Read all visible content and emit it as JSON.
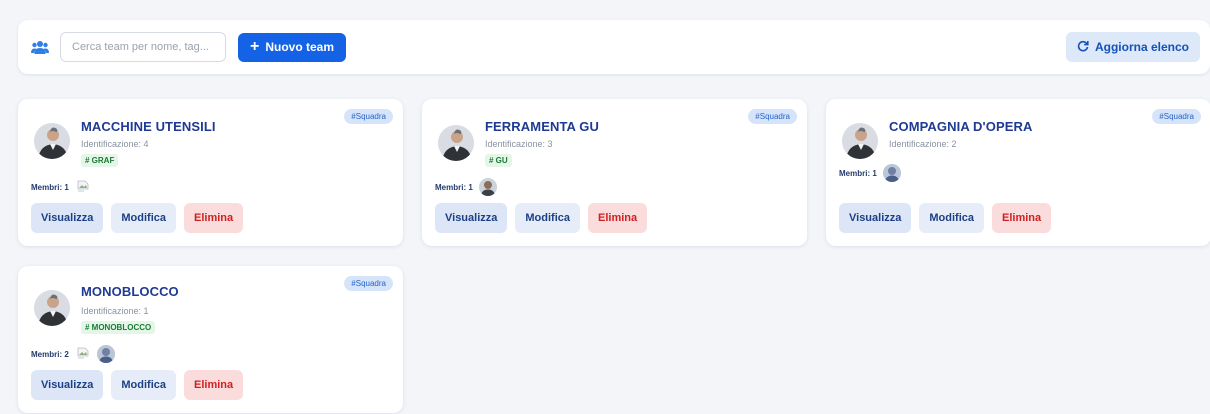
{
  "toolbar": {
    "icon": "users-icon",
    "search_placeholder": "Cerca team per nome, tag...",
    "search_value": "",
    "new_team_label": "Nuovo team",
    "refresh_label": "Aggiorna elenco"
  },
  "colors": {
    "primary": "#1463e6",
    "title": "#1f3a93",
    "danger": "#d01f1f",
    "tag_green": "#1e7a35"
  },
  "cards": [
    {
      "name": "MACCHINE UTENSILI",
      "ident": "Identificazione: 4",
      "tag": "# GRAF",
      "badge": "#Squadra",
      "members_label": "Membri: 1",
      "view": "Visualizza",
      "edit": "Modifica",
      "delete": "Elimina"
    },
    {
      "name": "FERRAMENTA GU",
      "ident": "Identificazione: 3",
      "tag": "# GU",
      "badge": "#Squadra",
      "members_label": "Membri: 1",
      "view": "Visualizza",
      "edit": "Modifica",
      "delete": "Elimina"
    },
    {
      "name": "COMPAGNIA D'OPERA",
      "ident": "Identificazione: 2",
      "badge": "#Squadra",
      "members_label": "Membri: 1",
      "view": "Visualizza",
      "edit": "Modifica",
      "delete": "Elimina"
    },
    {
      "name": "MONOBLOCCO",
      "ident": "Identificazione: 1",
      "tag": "# MONOBLOCCO",
      "badge": "#Squadra",
      "members_label": "Membri: 2",
      "view": "Visualizza",
      "edit": "Modifica",
      "delete": "Elimina"
    }
  ]
}
